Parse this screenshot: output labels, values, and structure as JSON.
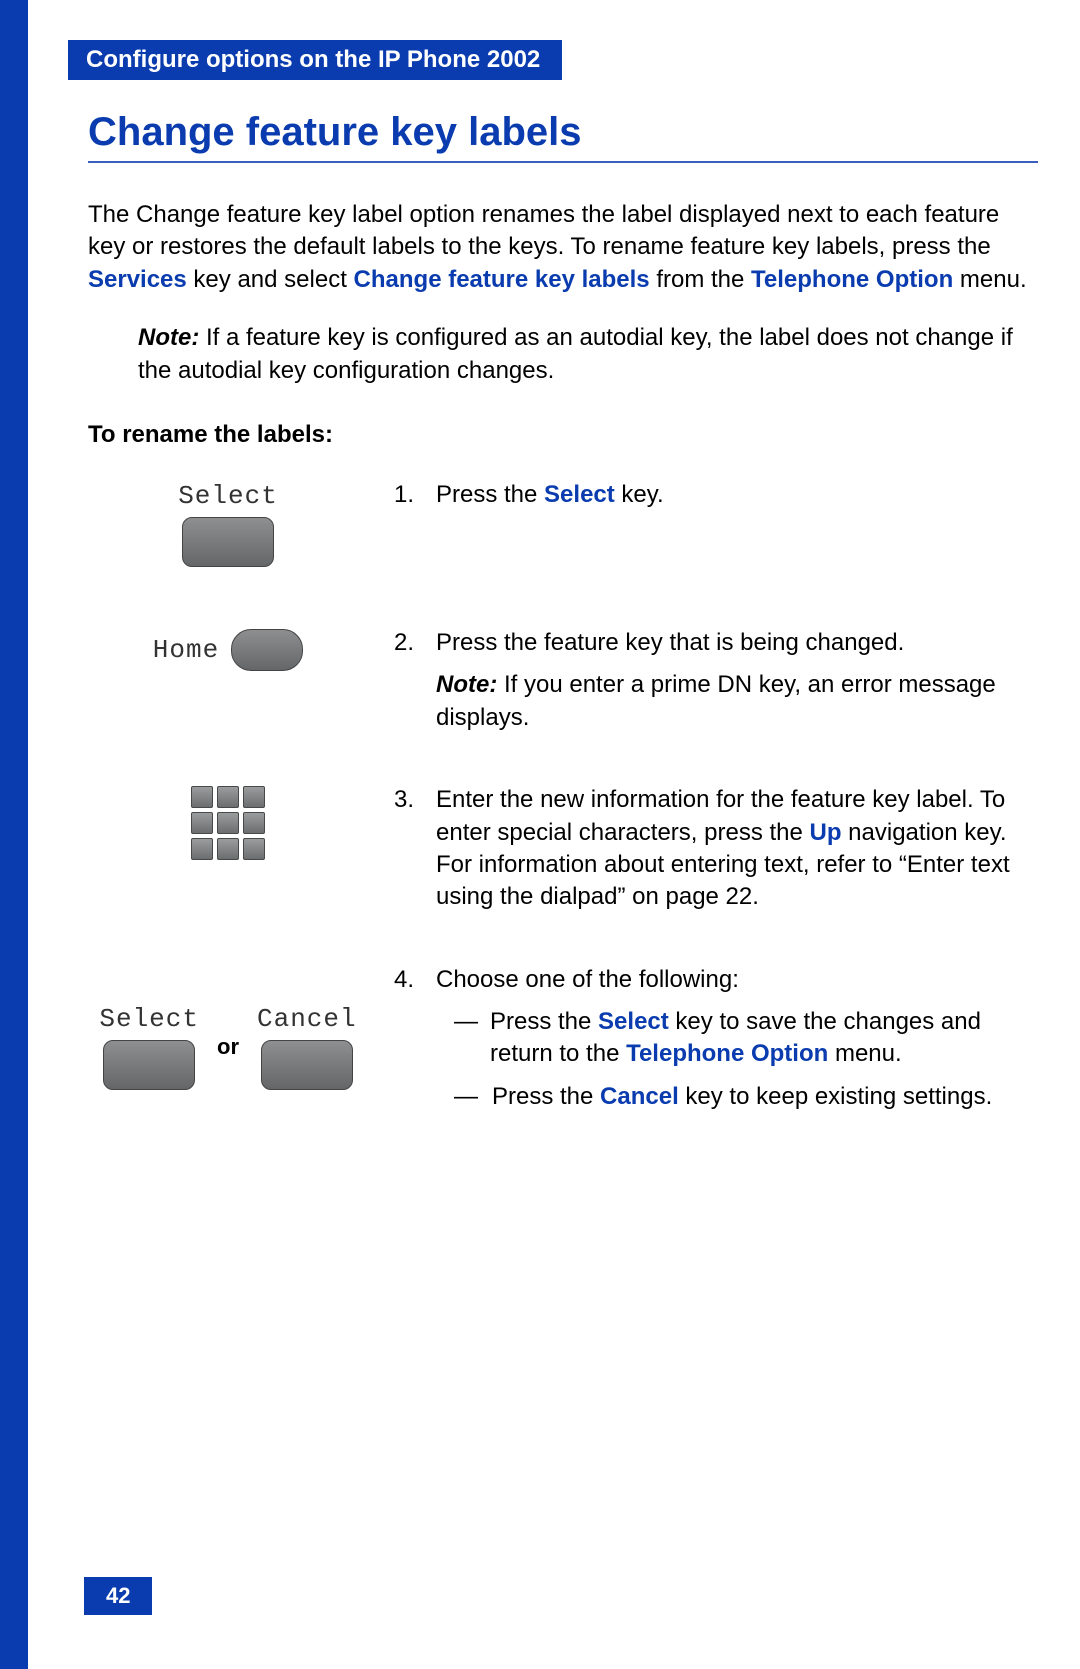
{
  "header": {
    "tab": "Configure options on the IP Phone 2002"
  },
  "heading": "Change feature key labels",
  "intro": {
    "part1": "The Change feature key label option renames the label displayed next to each feature key or restores the default labels to the keys. To rename feature key labels, press the ",
    "services": "Services",
    "part2": " key and select ",
    "changefk": "Change feature key labels",
    "part3": " from the ",
    "telopt": "Telephone Option",
    "part4": " menu."
  },
  "note1": {
    "label": "Note:",
    "body": " If a feature key is configured as an autodial key, the label does not change if the autodial key configuration changes."
  },
  "subhead": "To rename the labels:",
  "keys": {
    "select": "Select",
    "home": "Home",
    "cancel": "Cancel",
    "or": "or"
  },
  "steps": {
    "s1": {
      "num": "1.",
      "a": "Press the ",
      "select": "Select",
      "b": " key."
    },
    "s2": {
      "num": "2.",
      "body": "Press the feature key that is being changed.",
      "note_label": "Note:",
      "note_body": " If you enter a prime DN key, an error message displays."
    },
    "s3": {
      "num": "3.",
      "a": "Enter the new information for the feature key label. To enter special characters, press the ",
      "up": "Up",
      "b": " navigation key. For information about entering text, refer to “Enter text using the dialpad” on page 22."
    },
    "s4": {
      "num": "4.",
      "lead": "Choose one of the following:",
      "c1a": "Press the ",
      "c1sel": "Select",
      "c1b": " key to save the changes and return to the ",
      "c1tel": "Telephone Option",
      "c1c": " menu.",
      "c2a": "Press the ",
      "c2can": "Cancel",
      "c2b": " key to keep existing settings."
    }
  },
  "page_number": "42"
}
